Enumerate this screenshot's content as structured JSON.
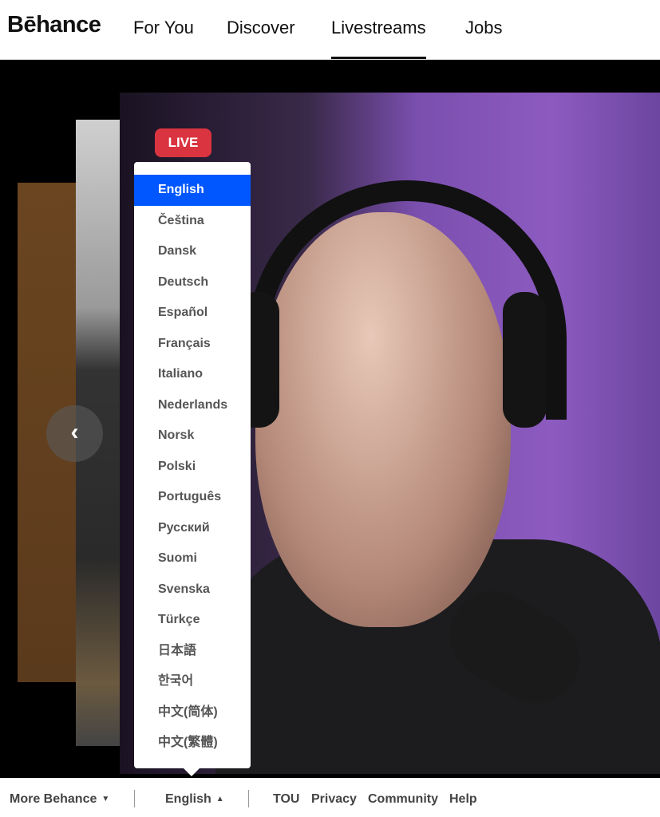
{
  "header": {
    "logo": "Bēhance",
    "nav": [
      {
        "label": "For You"
      },
      {
        "label": "Discover"
      },
      {
        "label": "Livestreams",
        "active": true
      },
      {
        "label": "Jobs"
      }
    ]
  },
  "stream": {
    "badge": "LIVE",
    "prev_icon": "chevron-left-icon"
  },
  "language_menu": {
    "selected": "English",
    "options": [
      "English",
      "Čeština",
      "Dansk",
      "Deutsch",
      "Español",
      "Français",
      "Italiano",
      "Nederlands",
      "Norsk",
      "Polski",
      "Português",
      "Русский",
      "Suomi",
      "Svenska",
      "Türkçe",
      "日本語",
      "한국어",
      "中文(简体)",
      "中文(繁體)"
    ]
  },
  "footer": {
    "more": "More Behance",
    "more_icon": "▼",
    "language": "English",
    "language_icon": "▲",
    "links": [
      "TOU",
      "Privacy",
      "Community",
      "Help"
    ]
  },
  "colors": {
    "accent": "#0057ff",
    "live": "#d9343f"
  }
}
